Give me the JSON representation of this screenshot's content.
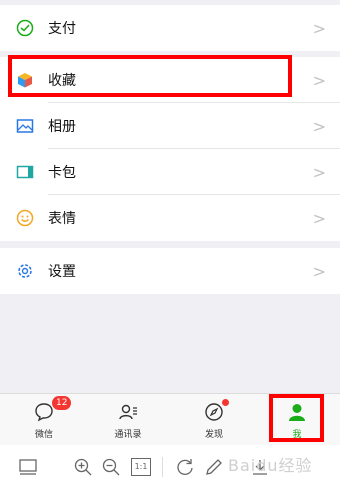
{
  "menu": {
    "group1": [
      {
        "label": "支付",
        "icon": "wechat-pay-icon"
      }
    ],
    "group2": [
      {
        "label": "收藏",
        "icon": "favorites-cube-icon"
      },
      {
        "label": "相册",
        "icon": "photo-album-icon"
      },
      {
        "label": "卡包",
        "icon": "card-wallet-icon"
      },
      {
        "label": "表情",
        "icon": "sticker-smiley-icon"
      }
    ],
    "group3": [
      {
        "label": "设置",
        "icon": "gear-icon"
      }
    ],
    "chevron": ">"
  },
  "tabbar": {
    "tabs": [
      {
        "label": "微信",
        "icon": "chat-bubble-icon",
        "badge": "12"
      },
      {
        "label": "通讯录",
        "icon": "contacts-icon"
      },
      {
        "label": "发现",
        "icon": "compass-icon",
        "dot": true
      },
      {
        "label": "我",
        "icon": "me-person-icon",
        "active": true
      }
    ]
  },
  "toolbar": {
    "zoom_ratio": "1:1",
    "watermark": "Baidu经验"
  },
  "colors": {
    "accent_green": "#1aad19",
    "highlight_red": "#ff0000",
    "badge_red": "#f43530"
  }
}
